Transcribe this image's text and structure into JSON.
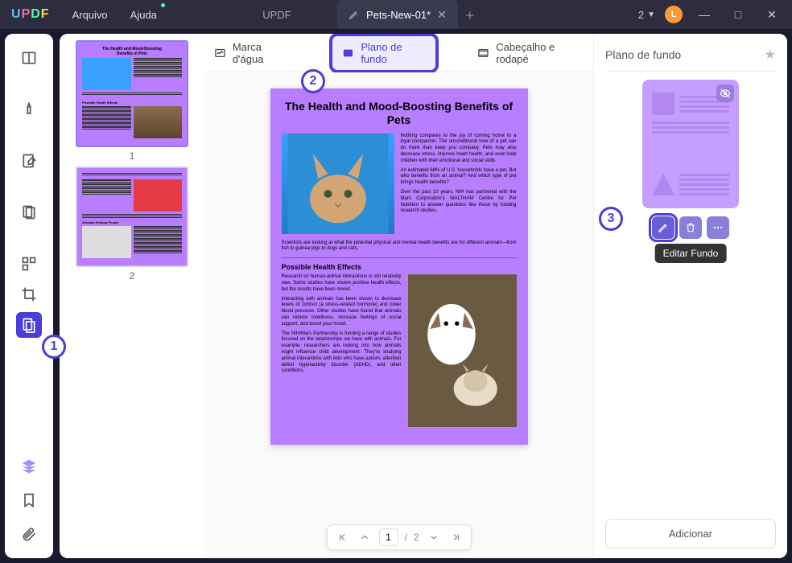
{
  "app": {
    "logo_letters": [
      "U",
      "P",
      "D",
      "F"
    ]
  },
  "menu": {
    "file": "Arquivo",
    "help": "Ajuda"
  },
  "tabs": {
    "inactive": "UPDF",
    "active": "Pets-New-01*"
  },
  "user": {
    "count": "2",
    "initial": "L"
  },
  "toolbar": {
    "watermark": "Marca d'água",
    "background": "Plano de fundo",
    "header_footer": "Cabeçalho e rodapé"
  },
  "thumbnails": {
    "p1": "1",
    "p2": "2"
  },
  "document": {
    "title": "The Health and Mood-Boosting Benefits of Pets",
    "p1": "Nothing compares to the joy of coming home to a loyal companion. The unconditional love of a pet can do more than keep you company. Pets may also decrease stress, improve heart health, and even help children with their emotional and social skills.",
    "p2": "An estimated 68% of U.S. households have a pet. But who benefits from an animal? And which type of pet brings health benefits?",
    "p3": "Over the past 10 years, NIH has partnered with the Mars Corporation's WALTHAM Centre for Pet Nutrition to answer questions like these by funding research studies.",
    "p4": "Scientists are looking at what the potential physical and mental health benefits are for different animals—from fish to guinea pigs to dogs and cats.",
    "h2": "Possible Health Effects",
    "p5": "Research on human-animal interactions is still relatively new. Some studies have shown positive health effects, but the results have been mixed.",
    "p6": "Interacting with animals has been shown to decrease levels of cortisol (a stress-related hormone) and lower blood pressure. Other studies have found that animals can reduce loneliness, increase feelings of social support, and boost your mood.",
    "p7": "The NIH/Mars Partnership is funding a range of studies focused on the relationships we have with animals. For example, researchers are looking into how animals might influence child development. They're studying animal interactions with kids who have autism, attention deficit hyperactivity disorder (ADHD), and other conditions."
  },
  "pager": {
    "current": "1",
    "total": "2"
  },
  "rpanel": {
    "title": "Plano de fundo",
    "tooltip": "Editar Fundo",
    "add": "Adicionar"
  },
  "annotations": {
    "a1": "1",
    "a2": "2",
    "a3": "3"
  }
}
